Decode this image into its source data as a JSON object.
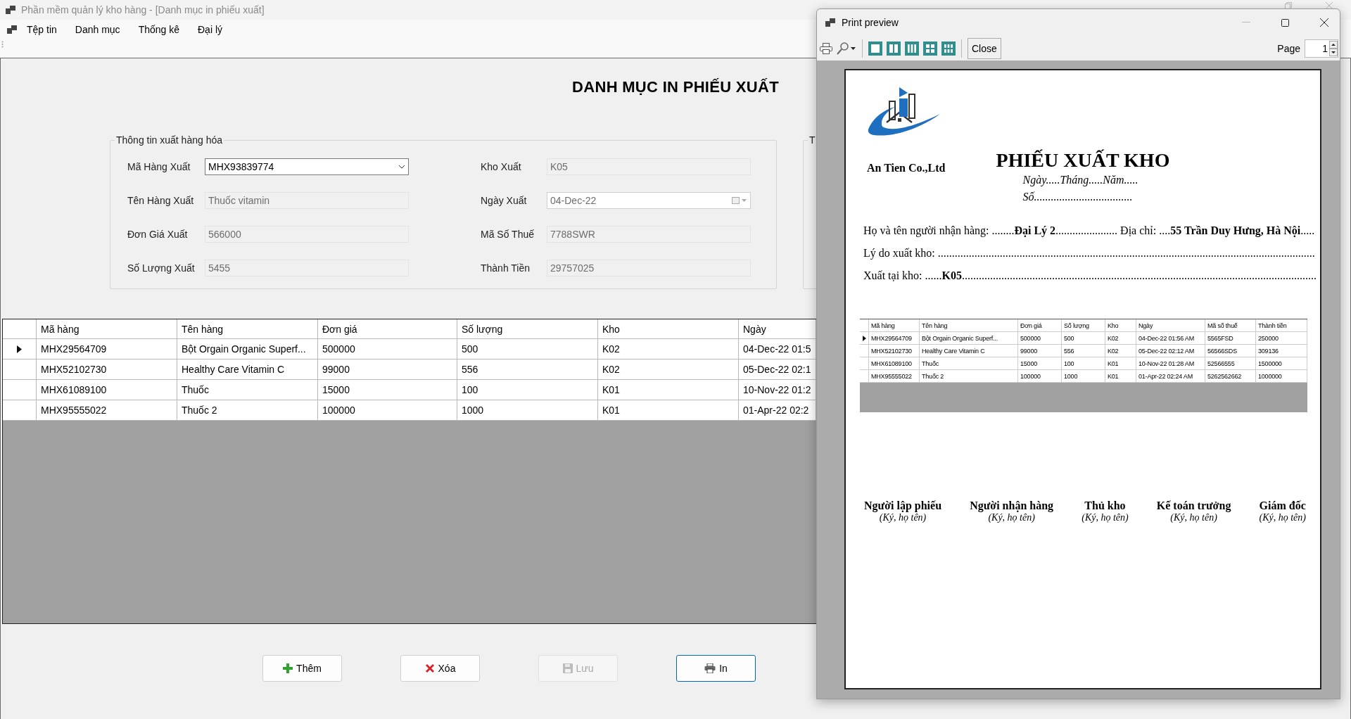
{
  "main_window": {
    "title": "Phần mềm quản lý kho hàng - [Danh mục in phiếu xuất]",
    "menu": [
      "Tệp tin",
      "Danh mục",
      "Thống kê",
      "Đại lý"
    ],
    "heading": "DANH MỤC IN PHIẾU XUẤT",
    "group": {
      "title": "Thông tin xuất hàng hóa",
      "left_fields": [
        {
          "label": "Mã Hàng Xuất",
          "value": "MHX93839774",
          "kind": "combo",
          "disabled": false
        },
        {
          "label": "Tên Hàng Xuất",
          "value": "Thuốc vitamin",
          "kind": "text",
          "disabled": true
        },
        {
          "label": "Đơn Giá Xuất",
          "value": "566000",
          "kind": "text",
          "disabled": true
        },
        {
          "label": "Số Lượng Xuất",
          "value": "5455",
          "kind": "text",
          "disabled": true
        }
      ],
      "right_fields": [
        {
          "label": "Kho Xuất",
          "value": "K05",
          "kind": "text",
          "disabled": true
        },
        {
          "label": "Ngày Xuất",
          "value": "04-Dec-22",
          "kind": "date",
          "disabled": true
        },
        {
          "label": "Mã Số Thuế",
          "value": "7788SWR",
          "kind": "text",
          "disabled": true
        },
        {
          "label": "Thành Tiền",
          "value": "29757025",
          "kind": "text",
          "disabled": true
        }
      ]
    },
    "group2": {
      "title": "T"
    },
    "grid": {
      "columns": [
        "Mã hàng",
        "Tên hàng",
        "Đơn giá",
        "Số lượng",
        "Kho",
        "Ngày"
      ],
      "rows": [
        {
          "selected": true,
          "cells": [
            "MHX29564709",
            "Bột Orgain Organic Superf...",
            "500000",
            "500",
            "K02",
            "04-Dec-22 01:5"
          ]
        },
        {
          "selected": false,
          "cells": [
            "MHX52102730",
            "Healthy Care Vitamin C",
            "99000",
            "556",
            "K02",
            "05-Dec-22 02:1"
          ]
        },
        {
          "selected": false,
          "cells": [
            "MHX61089100",
            "Thuốc",
            "15000",
            "100",
            "K01",
            "10-Nov-22 01:2"
          ]
        },
        {
          "selected": false,
          "cells": [
            "MHX95555022",
            "Thuốc 2",
            "100000",
            "1000",
            "K01",
            "01-Apr-22 02:2"
          ]
        }
      ]
    },
    "buttons": [
      {
        "label": "Thêm",
        "kind": "add",
        "disabled": false,
        "focused": false
      },
      {
        "label": "Xóa",
        "kind": "delete",
        "disabled": false,
        "focused": false
      },
      {
        "label": "Lưu",
        "kind": "save",
        "disabled": true,
        "focused": false
      },
      {
        "label": "In",
        "kind": "print",
        "disabled": false,
        "focused": true
      }
    ]
  },
  "print_preview": {
    "title": "Print preview",
    "close_label": "Close",
    "page_label": "Page",
    "page_value": "1",
    "document": {
      "company": "An Tien Co.,Ltd",
      "title": "PHIẾU XUẤT KHO",
      "date_line": "Ngày.....Tháng.....Năm.....",
      "number_line": "Số...................................",
      "lines": [
        "Họ và tên người nhận hàng: ........**Đại Lý 2**...................... Địa chỉ: ....**55 Trần Duy Hưng, Hà Nội**.....",
        "Lý do xuất kho: ......................................................................................................................................",
        "Xuất tại kho: ......**K05**.............................................................................................................................."
      ],
      "table": {
        "columns": [
          "Mã hàng",
          "Tên hàng",
          "Đơn giá",
          "Số lượng",
          "Kho",
          "Ngày",
          "Mã số thuế",
          "Thành tiền"
        ],
        "rows": [
          {
            "selected": true,
            "cells": [
              "MHX29564709",
              "Bột Orgain Organic Superf...",
              "500000",
              "500",
              "K02",
              "04-Dec-22 01:56 AM",
              "5565FSD",
              "250000"
            ]
          },
          {
            "selected": false,
            "cells": [
              "MHX52102730",
              "Healthy Care Vitamin C",
              "99000",
              "556",
              "K02",
              "05-Dec-22 02:12 AM",
              "56566SDS",
              "309136"
            ]
          },
          {
            "selected": false,
            "cells": [
              "MHX61089100",
              "Thuốc",
              "15000",
              "100",
              "K01",
              "10-Nov-22 01:28 AM",
              "52566555",
              "1500000"
            ]
          },
          {
            "selected": false,
            "cells": [
              "MHX95555022",
              "Thuốc 2",
              "100000",
              "1000",
              "K01",
              "01-Apr-22 02:24 AM",
              "5262562662",
              "1000000"
            ]
          }
        ]
      },
      "signatures": [
        {
          "role": "Người lập phiếu",
          "note": "(Ký, họ tên)"
        },
        {
          "role": "Người nhận hàng",
          "note": "(Ký, họ tên)"
        },
        {
          "role": "Thủ kho",
          "note": "(Ký, họ tên)"
        },
        {
          "role": "Kế toán trưởng",
          "note": "(Ký, họ tên)"
        },
        {
          "role": "Giám đốc",
          "note": "(Ký, họ tên)"
        }
      ]
    }
  }
}
